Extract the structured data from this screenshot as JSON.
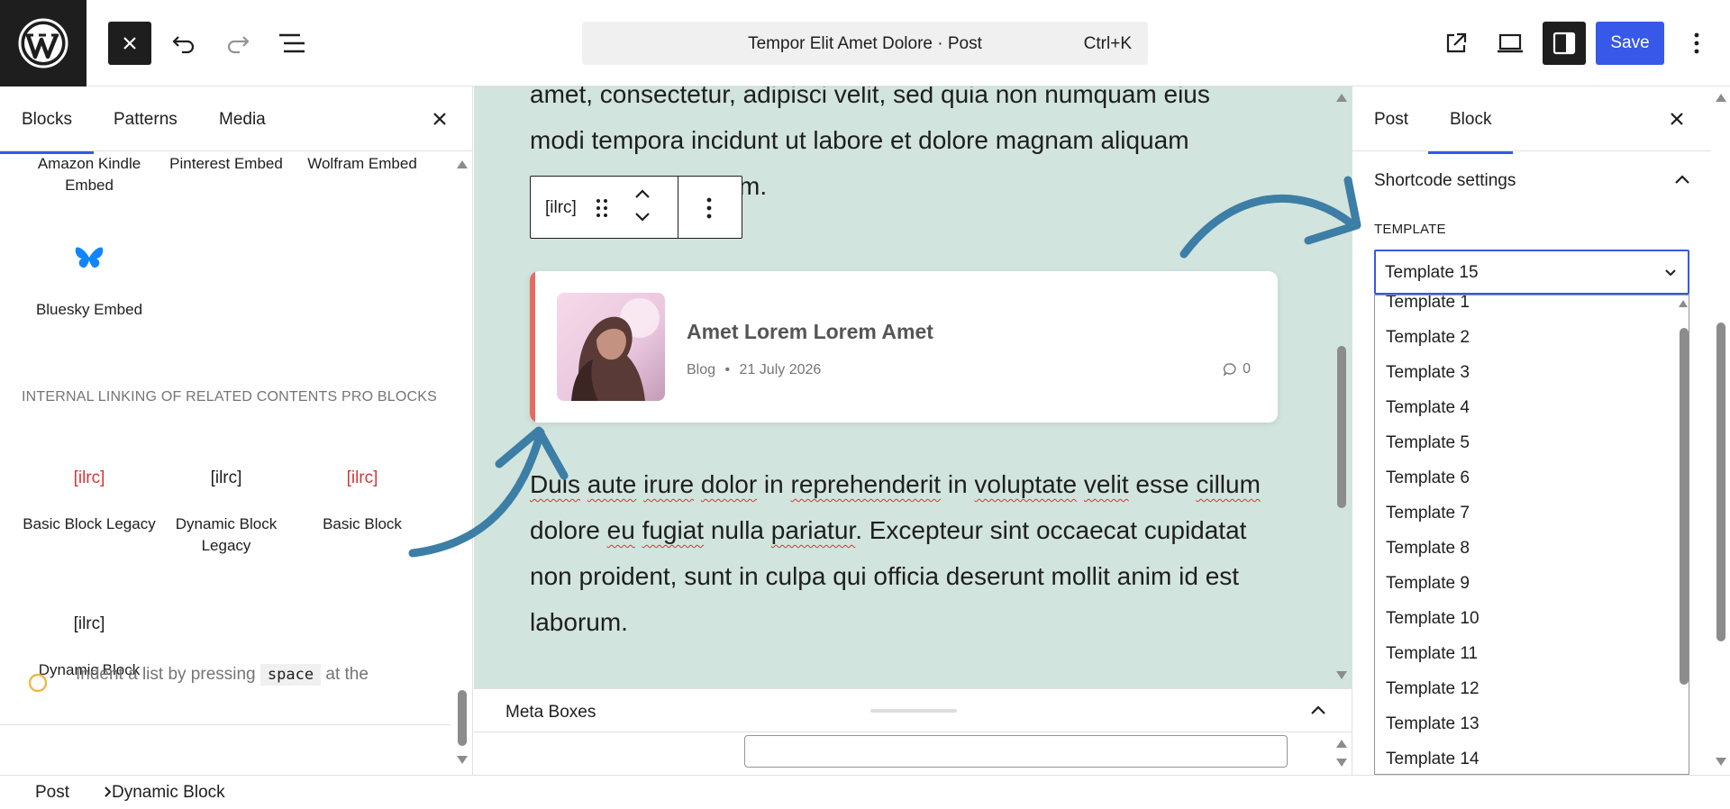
{
  "topbar": {
    "document_title": "Tempor Elit Amet Dolore · Post",
    "shortcut": "Ctrl+K",
    "save_label": "Save"
  },
  "inserter": {
    "tabs": [
      "Blocks",
      "Patterns",
      "Media"
    ],
    "embeds_row": [
      {
        "label": "Amazon Kindle Embed"
      },
      {
        "label": "Pinterest Embed"
      },
      {
        "label": "Wolfram Embed"
      }
    ],
    "bluesky": {
      "label": "Bluesky Embed"
    },
    "section_title": "INTERNAL LINKING OF RELATED CONTENTS PRO BLOCKS",
    "ilrc_blocks": [
      {
        "icon_text": "[ilrc]",
        "label": "Basic Block Legacy",
        "icon_color": "#d63638"
      },
      {
        "icon_text": "[ilrc]",
        "label": "Dynamic Block Legacy",
        "icon_color": "#1e1e1e"
      },
      {
        "icon_text": "[ilrc]",
        "label": "Basic Block",
        "icon_color": "#d63638"
      },
      {
        "icon_text": "[ilrc]",
        "label": "Dynamic Block",
        "icon_color": "#1e1e1e"
      }
    ],
    "tip": {
      "before": "Indent a list by pressing",
      "key": "space",
      "after": "at the"
    }
  },
  "canvas": {
    "para_top_line1": "amet, consectetur, adipisci velit, sed quia non numquam eius",
    "para_top_line2": "modi tempora incidunt ut labore et dolore magnam aliquam",
    "para_top_line3_tail": "m.",
    "block_toolbar_label": "[ilrc]",
    "card": {
      "title": "Amet Lorem Lorem Amet",
      "category": "Blog",
      "date": "21 July 2026",
      "comments": "0",
      "accent_color": "#e86a61"
    },
    "para_bottom_words": [
      {
        "t": "Duis",
        "s": true
      },
      {
        "t": " "
      },
      {
        "t": "aute",
        "s": true
      },
      {
        "t": " "
      },
      {
        "t": "irure",
        "s": true
      },
      {
        "t": " "
      },
      {
        "t": "dolor",
        "s": true
      },
      {
        "t": " in "
      },
      {
        "t": "reprehenderit",
        "s": true
      },
      {
        "t": " in "
      },
      {
        "t": "voluptate",
        "s": true
      },
      {
        "t": " "
      },
      {
        "t": "velit",
        "s": true
      },
      {
        "t": " esse "
      },
      {
        "t": "cillum",
        "s": true
      },
      {
        "t": " dolore "
      },
      {
        "t": "eu",
        "s": true
      },
      {
        "t": " "
      },
      {
        "t": "fugiat",
        "s": true
      },
      {
        "t": " nulla "
      },
      {
        "t": "pariatur",
        "s": true
      },
      {
        "t": ". Excepteur sint occaecat cupidatat non proident, sunt in culpa qui officia deserunt mollit anim id est laborum."
      }
    ],
    "background": "#d1e4dd"
  },
  "metabox": {
    "title": "Meta Boxes"
  },
  "sidebar": {
    "tabs": [
      "Post",
      "Block"
    ],
    "panel_title": "Shortcode settings",
    "field_label": "TEMPLATE",
    "selected": "Template 15",
    "options": [
      "Template 1",
      "Template 2",
      "Template 3",
      "Template 4",
      "Template 5",
      "Template 6",
      "Template 7",
      "Template 8",
      "Template 9",
      "Template 10",
      "Template 11",
      "Template 12",
      "Template 13",
      "Template 14",
      "Template 15"
    ]
  },
  "breadcrumb": [
    "Post",
    "Dynamic Block"
  ],
  "colors": {
    "accent": "#3858e9",
    "arrow": "#3c7ea5",
    "selected_option": "#1c6bd6"
  }
}
